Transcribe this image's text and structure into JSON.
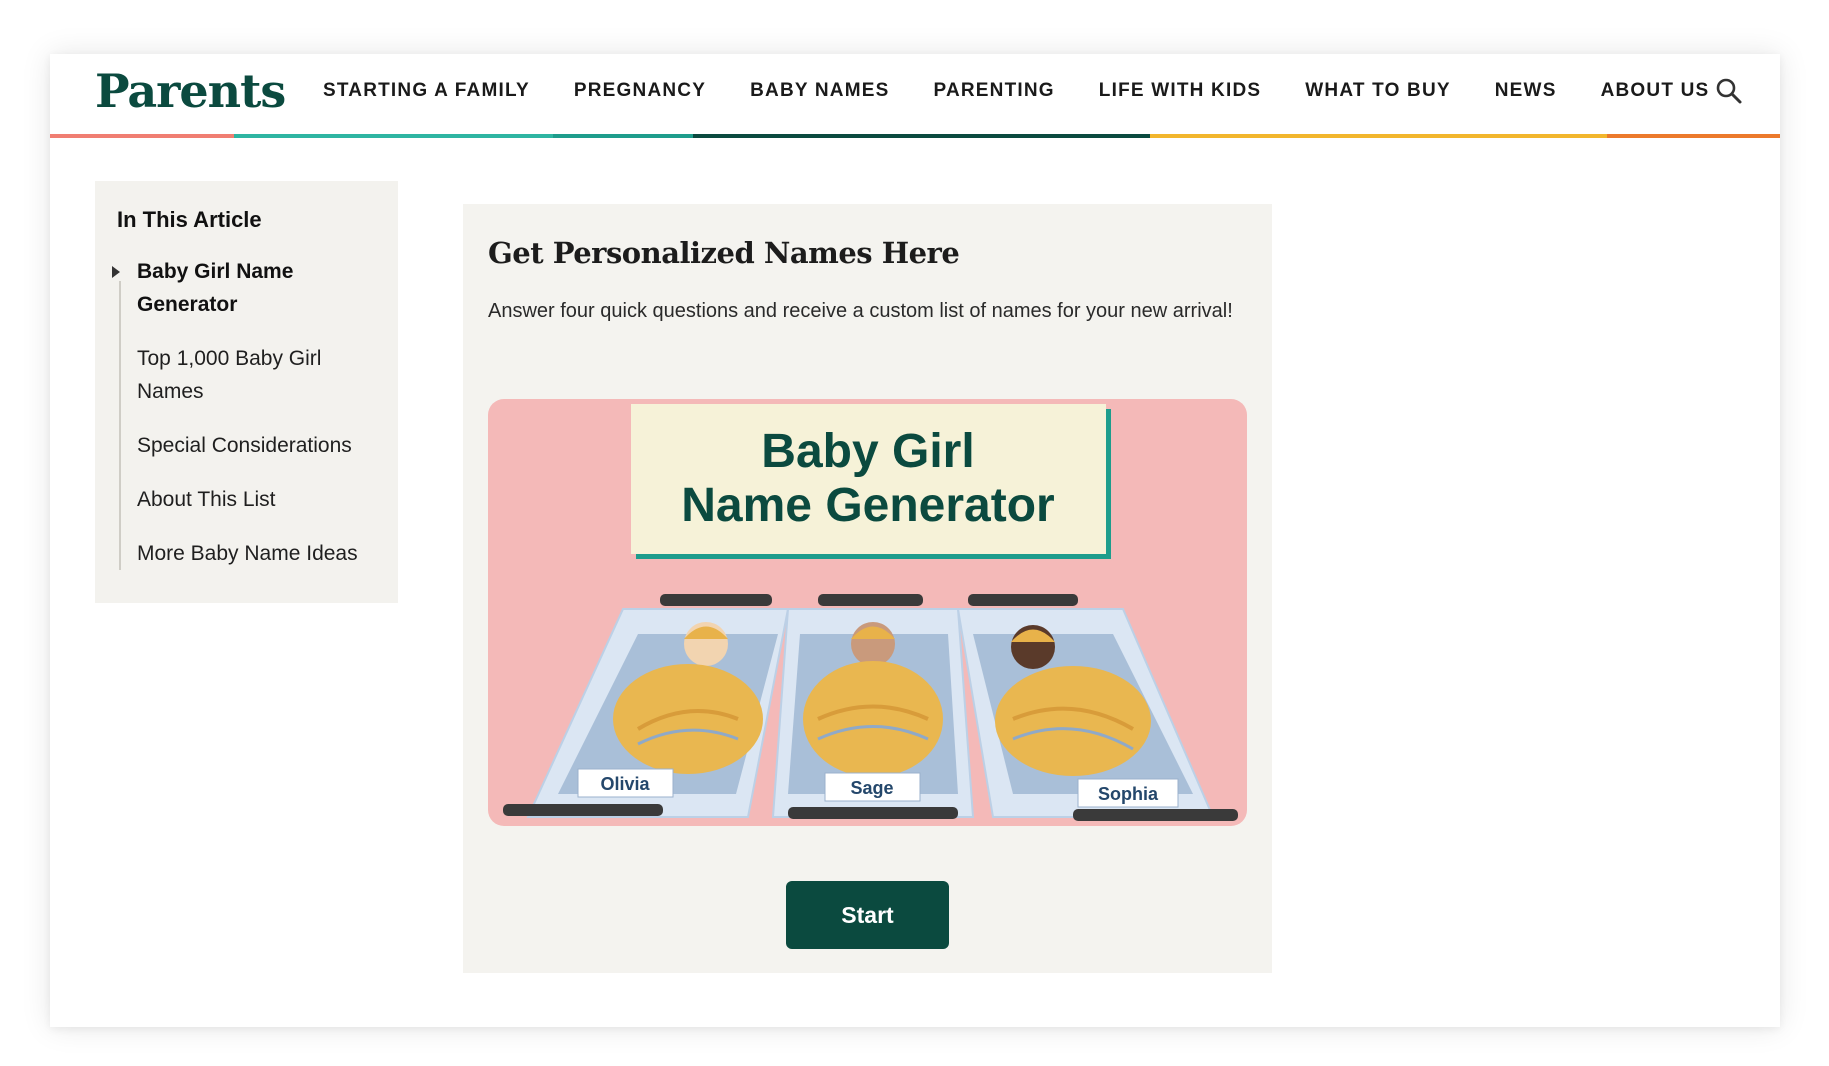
{
  "brand": {
    "logo_text": "Parents",
    "primary_color": "#0b4a3f"
  },
  "nav": {
    "items": [
      "STARTING A FAMILY",
      "PREGNANCY",
      "BABY NAMES",
      "PARENTING",
      "LIFE WITH KIDS",
      "WHAT TO BUY",
      "NEWS",
      "ABOUT US"
    ],
    "search_icon": "search-icon",
    "color_bar": [
      "#f07e72",
      "#2eb5a2",
      "#1e9d8c",
      "#0b4a3f",
      "#f2b62d",
      "#ec7a2c"
    ]
  },
  "toc": {
    "title": "In This Article",
    "items": [
      "Baby Girl Name Generator",
      "Top 1,000 Baby Girl Names",
      "Special Considerations",
      "About This List",
      "More Baby Name Ideas"
    ],
    "active_index": 0
  },
  "generator": {
    "title": "Get Personalized Names Here",
    "description": "Answer four quick questions and receive a custom list of names for your new arrival!",
    "image": {
      "heading_line1": "Baby Girl",
      "heading_line2": "Name Generator",
      "baby_names": [
        "Olivia",
        "Sage",
        "Sophia"
      ],
      "background_color": "#f4b9b8"
    },
    "start_label": "Start"
  }
}
